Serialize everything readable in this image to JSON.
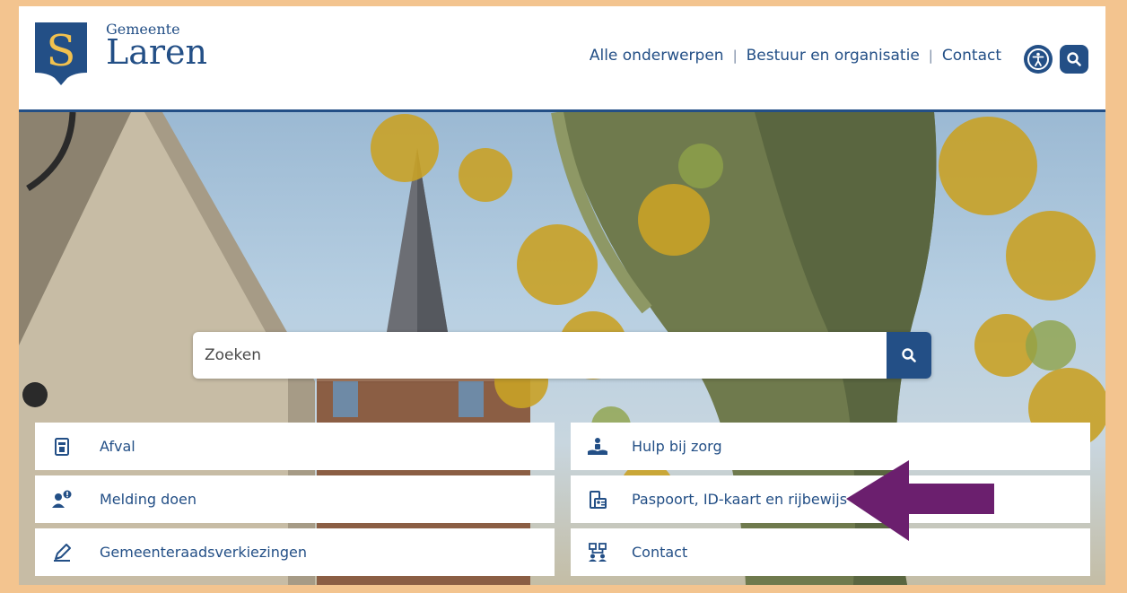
{
  "header": {
    "logo_letter": "S",
    "logo_small": "Gemeente",
    "logo_big": "Laren",
    "nav": [
      "Alle onderwerpen",
      "Bestuur en organisatie",
      "Contact"
    ],
    "nav_separator": "|"
  },
  "search": {
    "placeholder": "Zoeken"
  },
  "tiles": {
    "left": [
      {
        "label": "Afval",
        "icon": "waste-bin-icon"
      },
      {
        "label": "Melding doen",
        "icon": "report-person-icon"
      },
      {
        "label": "Gemeenteraadsverkiezingen",
        "icon": "pencil-icon"
      }
    ],
    "right": [
      {
        "label": "Hulp bij zorg",
        "icon": "care-hands-icon"
      },
      {
        "label": "Paspoort, ID-kaart en rijbewijs",
        "icon": "id-card-icon"
      },
      {
        "label": "Contact",
        "icon": "contact-org-icon"
      }
    ]
  },
  "colors": {
    "brand_blue": "#234f86",
    "logo_gold": "#f2c14e",
    "frame_border": "#f3c48f",
    "arrow_purple": "#6b1f6e"
  }
}
